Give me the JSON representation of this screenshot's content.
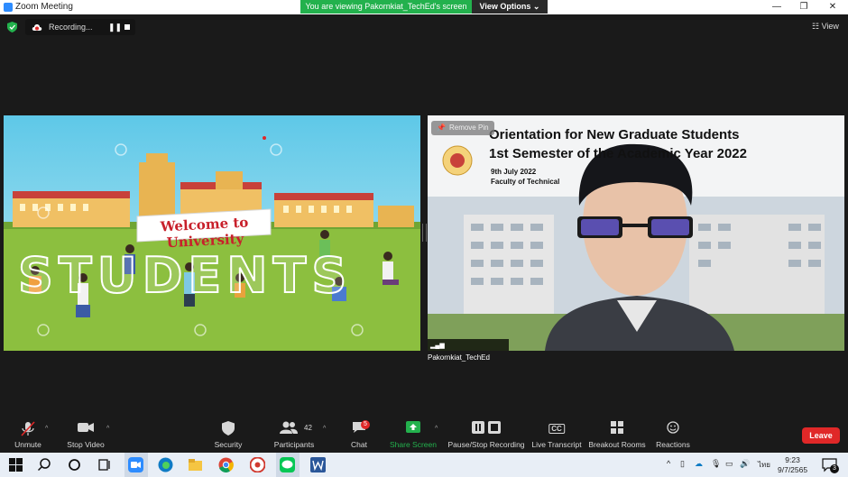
{
  "window": {
    "title": "Zoom Meeting",
    "minimize": "—",
    "restore": "❐",
    "close": "✕"
  },
  "banner": {
    "text": "You are viewing Pakornkiat_TechEd's screen",
    "view_options": "View Options ⌄"
  },
  "recording": {
    "label": "Recording...",
    "pause": "❚❚"
  },
  "view_button": "☷ View",
  "share": {
    "banner_text": "Welcome to University",
    "big_word": "STUDENTS"
  },
  "video": {
    "slide_title_1": "Orientation for New Graduate Students",
    "slide_title_2": "1st Semester of the Academic Year 2022",
    "slide_date": "9th July 2022",
    "slide_faculty": "Faculty of Technical",
    "remove_pin": "Remove Pin",
    "participant_name": "Pakornkiat_TechEd"
  },
  "toolbar": {
    "unmute": "Unmute",
    "stop_video": "Stop Video",
    "security": "Security",
    "participants": "Participants",
    "participants_count": "42",
    "chat": "Chat",
    "chat_badge": "5",
    "share_screen": "Share Screen",
    "pause_recording": "Pause/Stop Recording",
    "live_transcript": "Live Transcript",
    "breakout_rooms": "Breakout Rooms",
    "reactions": "Reactions",
    "leave": "Leave",
    "cc": "CC"
  },
  "taskbar": {
    "lang": "ไทย",
    "time": "9:23",
    "date": "9/7/2565",
    "notif_count": "3"
  },
  "colors": {
    "accent": "#2d8cff",
    "green": "#23b14d",
    "leave": "#e02828"
  }
}
